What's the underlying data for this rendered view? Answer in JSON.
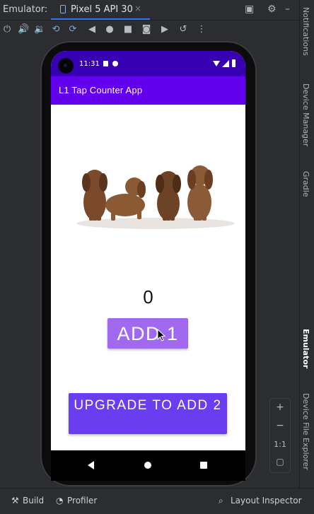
{
  "ide": {
    "emulator_label": "Emulator:",
    "device_tab": "Pixel 5 API 30",
    "close_glyph": "×",
    "toolbar_icons": [
      "power-icon",
      "volume-up-icon",
      "volume-down-icon",
      "rotate-left-icon",
      "rotate-right-icon",
      "back-icon",
      "home-icon",
      "overview-icon",
      "screenshot-icon",
      "record-icon",
      "snapshot-icon",
      "more-icon"
    ],
    "window_icons": [
      "layout-icon",
      "gear-icon",
      "minimize-icon"
    ],
    "right_tabs": [
      "Notifications",
      "Device Manager",
      "Gradle",
      "Emulator",
      "Device File Explorer"
    ],
    "zoom": {
      "plus": "+",
      "minus": "−",
      "ratio": "1:1"
    },
    "bottom_tabs": {
      "build": "Build",
      "profiler": "Profiler",
      "layout_inspector": "Layout Inspector"
    }
  },
  "phone": {
    "time": "11:31",
    "app_title": "L1 Tap Counter App",
    "counter": "0",
    "add_button": "ADD 1",
    "upgrade_button": "UPGRADE TO ADD 2"
  },
  "colors": {
    "status_bar": "#3700b3",
    "app_bar": "#6200ee",
    "add_button": "#a069f0",
    "upgrade_button": "#6a3df0",
    "tab_underline": "#3574f0"
  }
}
